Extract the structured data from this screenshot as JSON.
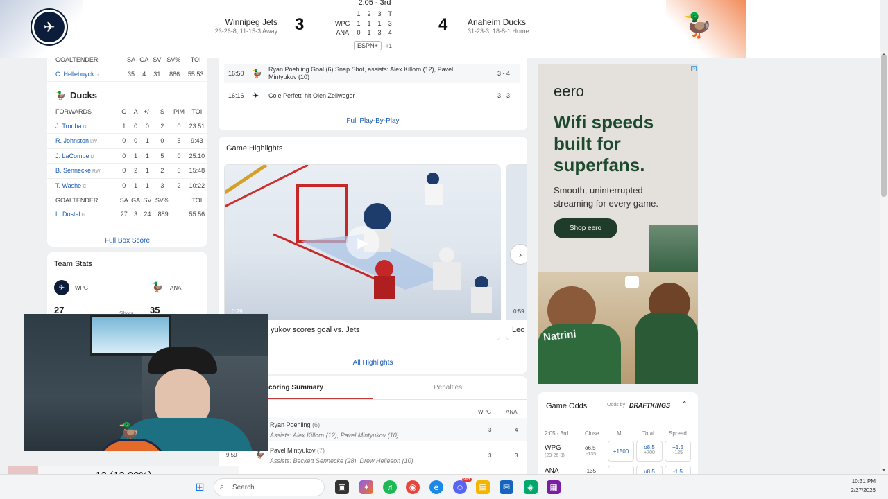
{
  "header": {
    "period": "2:05 - 3rd",
    "linescore": {
      "periods": [
        "1",
        "2",
        "3",
        "T"
      ],
      "rows": [
        {
          "team": "WPG",
          "scores": [
            "1",
            "1",
            "1",
            "3"
          ]
        },
        {
          "team": "ANA",
          "scores": [
            "0",
            "1",
            "3",
            "4"
          ]
        }
      ]
    },
    "network": "ESPN+",
    "network_extra": "+1",
    "away": {
      "name": "Winnipeg Jets",
      "record": "23-26-8, 11-15-3 Away",
      "score": "3"
    },
    "home": {
      "name": "Anaheim Ducks",
      "record": "31-23-3, 18-8-1 Home",
      "score": "4"
    }
  },
  "boxscore": {
    "goalie_header": [
      "GOALTENDER",
      "SA",
      "GA",
      "SV",
      "SV%",
      "TOI"
    ],
    "jets_goalie": {
      "name": "C. Hellebuyck",
      "pos": "G",
      "sa": "35",
      "ga": "4",
      "sv": "31",
      "svp": ".886",
      "toi": "55:53"
    },
    "ducks_title": "Ducks",
    "forwards_header": [
      "FORWARDS",
      "G",
      "A",
      "+/-",
      "S",
      "PIM",
      "TOI"
    ],
    "forwards": [
      {
        "name": "J. Trouba",
        "pos": "D",
        "g": "1",
        "a": "0",
        "pm": "0",
        "s": "2",
        "pim": "0",
        "toi": "23:51"
      },
      {
        "name": "R. Johnston",
        "pos": "LW",
        "g": "0",
        "a": "0",
        "pm": "1",
        "s": "0",
        "pim": "5",
        "toi": "9:43"
      },
      {
        "name": "J. LaCombe",
        "pos": "D",
        "g": "0",
        "a": "1",
        "pm": "1",
        "s": "5",
        "pim": "0",
        "toi": "25:10"
      },
      {
        "name": "B. Sennecke",
        "pos": "RW",
        "g": "0",
        "a": "2",
        "pm": "1",
        "s": "2",
        "pim": "0",
        "toi": "15:48"
      },
      {
        "name": "T. Washe",
        "pos": "C",
        "g": "0",
        "a": "1",
        "pm": "1",
        "s": "3",
        "pim": "2",
        "toi": "10:22"
      }
    ],
    "ducks_goalie": {
      "name": "L. Dostal",
      "pos": "G",
      "sa": "27",
      "ga": "3",
      "sv": "24",
      "svp": ".889",
      "toi": "55:56"
    },
    "full_link": "Full Box Score"
  },
  "team_stats": {
    "title": "Team Stats",
    "away_abbr": "WPG",
    "home_abbr": "ANA",
    "away_shots": "27",
    "home_shots": "35",
    "shots_label": "Shots"
  },
  "plays": {
    "rows": [
      {
        "time": "16:50",
        "text": "Ryan Poehling Goal (6) Snap Shot, assists: Alex Killorn (12), Pavel Mintyukov (10)",
        "score": "3 - 4"
      },
      {
        "time": "16:16",
        "text": "Cole Perfetti hit Olen Zellweger",
        "score": "3 - 3"
      }
    ],
    "full_link": "Full Play-By-Play"
  },
  "highlights": {
    "title": "Game Highlights",
    "videos": [
      {
        "duration": "0:29",
        "caption": "yukov scores goal vs. Jets"
      },
      {
        "duration": "0:59",
        "caption": "Leo"
      }
    ],
    "all_link": "All Highlights"
  },
  "scoring": {
    "tab_active": "coring Summary",
    "tab_other": "Penalties",
    "col_away": "WPG",
    "col_home": "ANA",
    "rows": [
      {
        "time": "",
        "player": "Ryan Poehling",
        "num": "(6)",
        "assists": "Assists: Alex Killorn (12), Pavel Mintyukov (10)",
        "away": "3",
        "home": "4"
      },
      {
        "time": "9:59",
        "player": "Pavel Mintyukov",
        "num": "(7)",
        "assists": "Assists: Beckett Sennecke (28), Drew Helleson (10)",
        "away": "3",
        "home": "3"
      }
    ]
  },
  "ad": {
    "brand": "eero",
    "headline": "Wifi speeds built for superfans.",
    "sub": "Smooth, uninterrupted streaming for every game.",
    "cta": "Shop eero",
    "jersey": "Natrini"
  },
  "odds": {
    "title": "Game Odds",
    "odds_by": "Odds by",
    "provider": "DRAFTKINGS",
    "headers": [
      "2:05 - 3rd",
      "Close",
      "ML",
      "Total",
      "Spread"
    ],
    "rows": [
      {
        "team": "WPG",
        "record": "(23-26-8)",
        "close": "o6.5",
        "close2": "-135",
        "ml": "+1500",
        "total": "o8.5",
        "total2": "+700",
        "spread": "+1.5",
        "spread2": "-125"
      },
      {
        "team": "ANA",
        "record": "",
        "close": "-135",
        "close2": "",
        "ml": "",
        "total": "u8.5",
        "total2": "",
        "spread": "-1.5",
        "spread2": ""
      }
    ]
  },
  "overlay": {
    "progress_text": "13 (13.00%)",
    "progress_value": 0.13
  },
  "taskbar": {
    "search": "Search",
    "time": "10:31 PM",
    "date": "2/27/2026",
    "badge": "99+"
  }
}
